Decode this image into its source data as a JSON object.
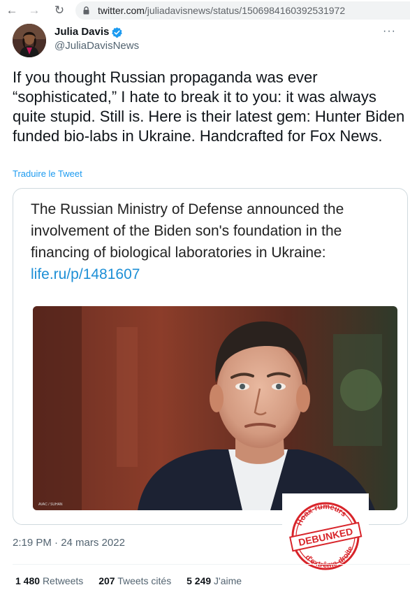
{
  "browser": {
    "url_host": "twitter.com",
    "url_path": "/juliadavisnews/status/1506984160392531972",
    "back_icon": "arrow-left-icon",
    "forward_icon": "arrow-right-icon",
    "reload_icon": "reload-icon",
    "lock_icon": "lock-icon"
  },
  "tweet": {
    "author_name": "Julia Davis",
    "author_handle": "@JuliaDavisNews",
    "verified_icon": "verified-badge-icon",
    "more_label": "···",
    "text": "If you thought Russian propaganda was ever “sophisticated,” I hate to break it to you: it was always quite stupid. Still is. Here is their latest gem: Hunter Biden funded bio-labs in Ukraine. Handcrafted for Fox News.",
    "translate_label": "Traduire le Tweet",
    "timestamp": "2:19 PM · 24 mars 2022",
    "accent_color": "#1d9bf0"
  },
  "card": {
    "text": "The Russian Ministry of Defense announced the involvement of the Biden son's foundation in the financing of biological laboratories in Ukraine:",
    "link": "life.ru/p/1481607",
    "photo_credit": "AVAC / SUHAN"
  },
  "stats": {
    "retweets_count": "1 480",
    "retweets_label": "Retweets",
    "quotes_count": "207",
    "quotes_label": "Tweets cités",
    "likes_count": "5 249",
    "likes_label": "J'aime"
  },
  "stamp": {
    "top_text": "Hoax-rumeurs",
    "center_text": "DEBUNKED",
    "bottom_text": "d'extrême-droite",
    "color": "#d8242a"
  }
}
